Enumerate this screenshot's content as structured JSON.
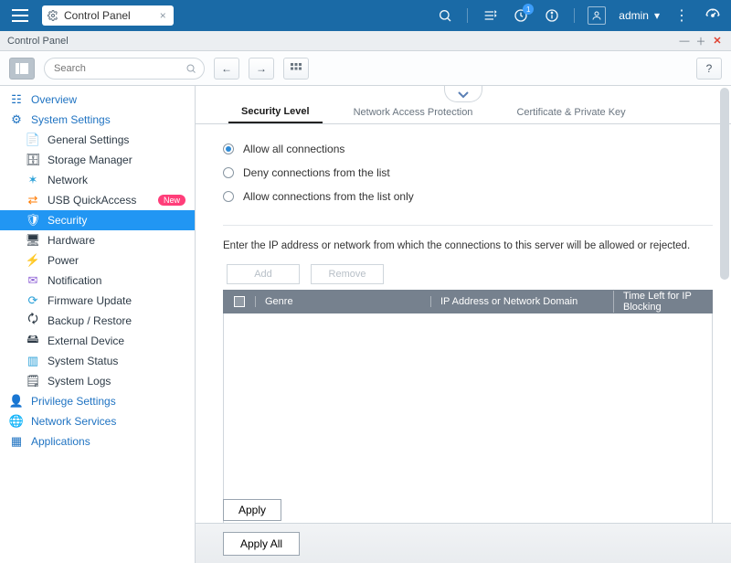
{
  "topbar": {
    "tab_label": "Control Panel",
    "notif_count": "1",
    "user_label": "admin"
  },
  "window": {
    "title": "Control Panel"
  },
  "toolbar": {
    "search_placeholder": "Search"
  },
  "sidebar": {
    "groups": [
      {
        "label": "Overview"
      },
      {
        "label": "System Settings"
      },
      {
        "label": "Privilege Settings"
      },
      {
        "label": "Network Services"
      },
      {
        "label": "Applications"
      }
    ],
    "system_items": [
      "General Settings",
      "Storage Manager",
      "Network",
      "USB QuickAccess",
      "Security",
      "Hardware",
      "Power",
      "Notification",
      "Firmware Update",
      "Backup / Restore",
      "External Device",
      "System Status",
      "System Logs"
    ],
    "new_badge": "New"
  },
  "main": {
    "tabs": [
      "Security Level",
      "Network Access Protection",
      "Certificate & Private Key"
    ],
    "radios": [
      "Allow all connections",
      "Deny connections from the list",
      "Allow connections from the list only"
    ],
    "description": "Enter the IP address or network from which the connections to this server will be allowed or rejected.",
    "add_label": "Add",
    "remove_label": "Remove",
    "columns": [
      "Genre",
      "IP Address or Network Domain",
      "Time Left for IP Blocking"
    ],
    "apply_label": "Apply",
    "apply_all_label": "Apply All"
  }
}
